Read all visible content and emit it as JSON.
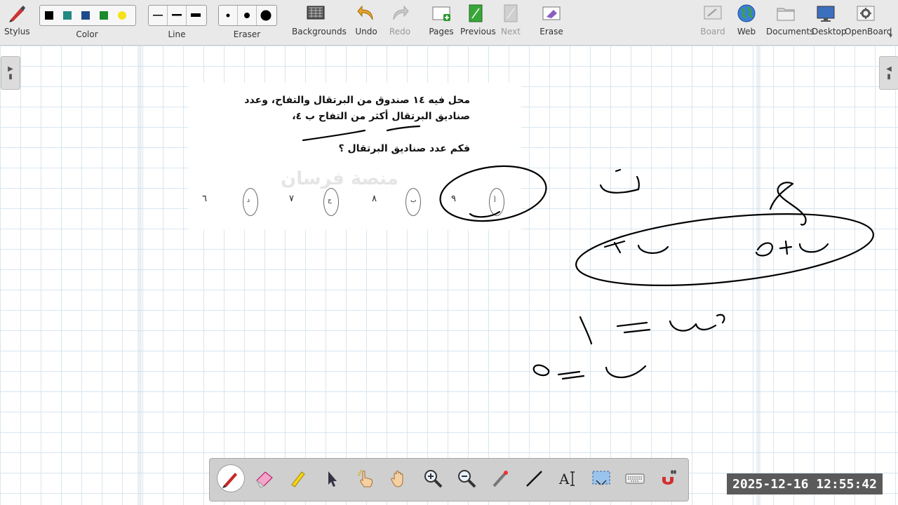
{
  "toolbar": {
    "stylus": "Stylus",
    "color": "Color",
    "line": "Line",
    "eraser": "Eraser",
    "backgrounds": "Backgrounds",
    "undo": "Undo",
    "redo": "Redo",
    "pages": "Pages",
    "previous": "Previous",
    "next": "Next",
    "erase": "Erase",
    "board": "Board",
    "web": "Web",
    "documents": "Documents",
    "desktop": "Desktop",
    "openboard": "OpenBoard",
    "colors": [
      "#000000",
      "#1f8a82",
      "#1f4a8a",
      "#1a8a2a",
      "#f5e21a"
    ]
  },
  "question": {
    "line1": "محل فيه ١٤ صندوق من البرتقال والتفاح، وعدد",
    "line2": "صناديق البرتقال أكثر من التفاح ب ٤،",
    "line3": "فكم عدد صناديق البرتقال ؟",
    "options": [
      {
        "letter": "أ",
        "value": "٩"
      },
      {
        "letter": "ب",
        "value": "٨"
      },
      {
        "letter": "ج",
        "value": "٧"
      },
      {
        "letter": "د",
        "value": "٦"
      }
    ],
    "watermark": "منصة فرسان"
  },
  "dock": {
    "tools": [
      "pen-tool",
      "eraser-tool",
      "highlighter-tool",
      "select-tool",
      "interact-tool",
      "hand-tool",
      "zoom-in-tool",
      "zoom-out-tool",
      "laser-pointer-tool",
      "line-tool",
      "text-tool",
      "capture-tool",
      "keyboard-tool",
      "magnet-tool"
    ]
  },
  "status": {
    "timestamp": "2025-12-16  12:55:42"
  }
}
